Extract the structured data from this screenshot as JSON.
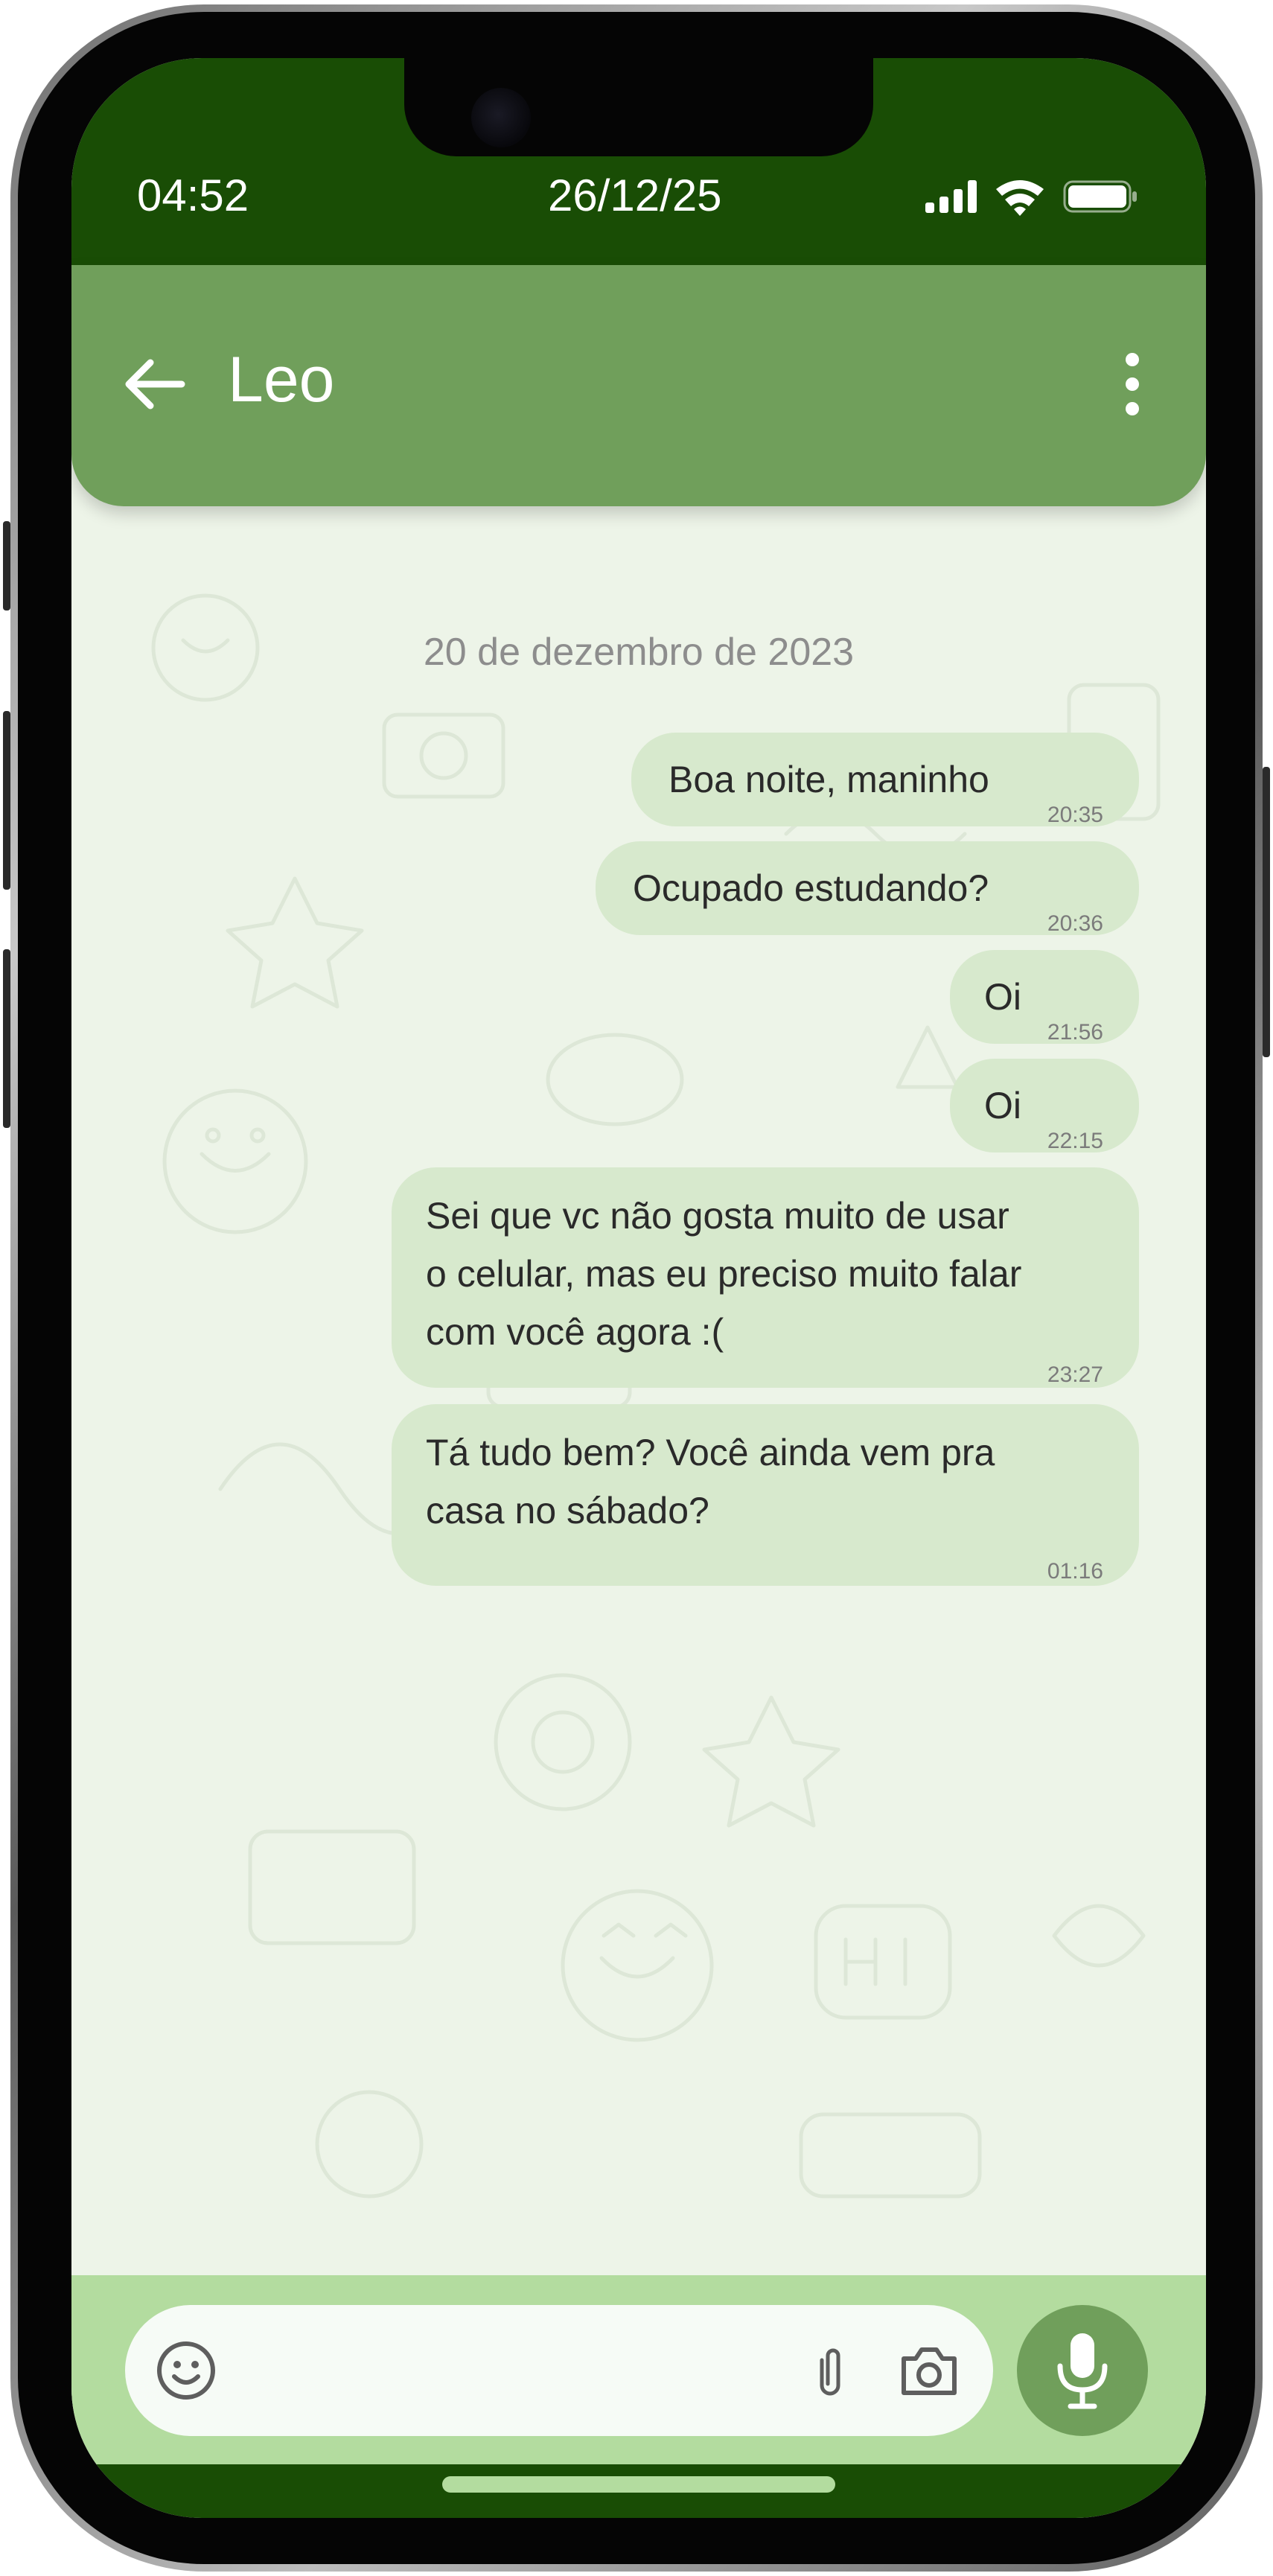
{
  "status_bar": {
    "time": "04:52",
    "date": "26/12/25",
    "signal_icon": "cellular-signal-icon",
    "wifi_icon": "wifi-icon",
    "battery_icon": "battery-icon"
  },
  "header": {
    "contact_name": "Leo",
    "back_icon": "arrow-left-icon",
    "menu_icon": "more-vertical-icon"
  },
  "chat": {
    "date_separator": "20 de dezembro de 2023",
    "messages": [
      {
        "text": "Boa noite, maninho",
        "time": "20:35"
      },
      {
        "text": "Ocupado estudando?",
        "time": "20:36"
      },
      {
        "text": "Oi",
        "time": "21:56"
      },
      {
        "text": "Oi",
        "time": "22:15"
      },
      {
        "text": "Sei que vc não gosta muito de usar\no celular, mas eu preciso muito falar\ncom você agora :(",
        "time": "23:27"
      },
      {
        "text": "Tá tudo bem? Você ainda vem pra\ncasa no sábado?",
        "time": "01:16"
      }
    ]
  },
  "input_bar": {
    "message_placeholder": "",
    "emoji_icon": "emoji-icon",
    "attach_icon": "paperclip-icon",
    "camera_icon": "camera-icon",
    "mic_icon": "microphone-icon"
  },
  "colors": {
    "status_bar": "#194d05",
    "header": "#709f5b",
    "chat_background": "#edf4e8",
    "bubble": "#d7e9cd",
    "input_bar": "#b3dc9f"
  }
}
